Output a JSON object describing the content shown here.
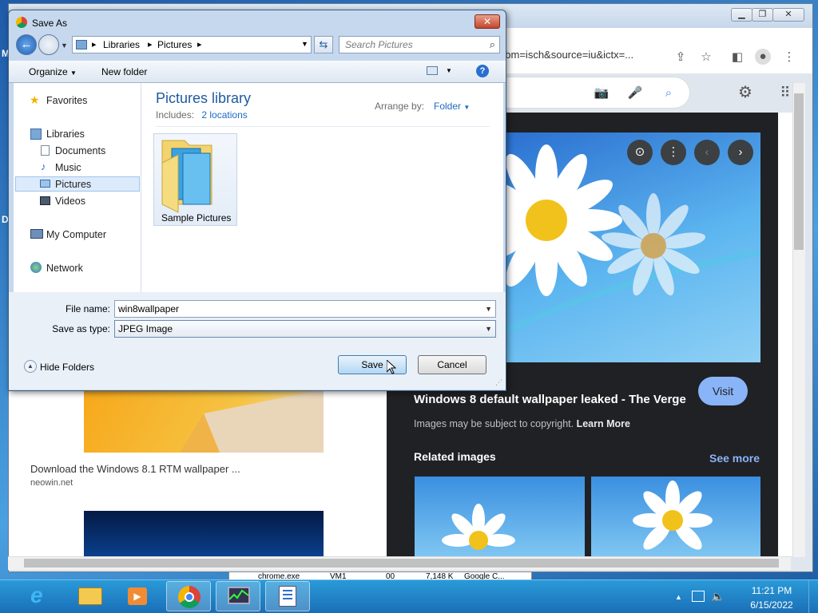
{
  "desktop": {
    "letters": [
      "M",
      "D"
    ]
  },
  "chrome": {
    "url_fragment": "&tbm=isch&source=iu&ictx=...",
    "preview_title": "Windows 8 default wallpaper leaked - The Verge",
    "visit_label": "Visit",
    "copyright_text": "Images may be subject to copyright.",
    "learn_more": "Learn More",
    "related_label": "Related images",
    "see_more_label": "See more",
    "result1_title": "Download the Windows 8.1 RTM wallpaper ...",
    "result1_source": "neowin.net",
    "icons": [
      "share-icon",
      "star-icon",
      "sidebar-icon",
      "profile-icon",
      "menu-icon",
      "camera-icon",
      "mic-icon",
      "search-icon",
      "settings-icon",
      "apps-icon"
    ]
  },
  "dialog": {
    "title": "Save As",
    "breadcrumb": [
      "Libraries",
      "Pictures"
    ],
    "search_placeholder": "Search Pictures",
    "toolbar": {
      "organize": "Organize",
      "new_folder": "New folder"
    },
    "nav": {
      "favorites": "Favorites",
      "libraries": "Libraries",
      "library_items": [
        "Documents",
        "Music",
        "Pictures",
        "Videos"
      ],
      "my_computer": "My Computer",
      "network": "Network"
    },
    "library_title": "Pictures library",
    "includes_label": "Includes:",
    "includes_link": "2 locations",
    "arrange_label": "Arrange by:",
    "arrange_value": "Folder",
    "folder_name": "Sample Pictures",
    "file_name_label": "File name:",
    "file_name_value": "win8wallpaper",
    "save_type_label": "Save as type:",
    "save_type_value": "JPEG Image",
    "hide_folders": "Hide Folders",
    "save_label": "Save",
    "cancel_label": "Cancel"
  },
  "task_manager_row": {
    "process": "chrome.exe",
    "user": "VM1",
    "cpu": "00",
    "memory": "7,148 K",
    "description": "Google C..."
  },
  "taskbar": {
    "time": "11:21 PM",
    "date": "6/15/2022"
  }
}
